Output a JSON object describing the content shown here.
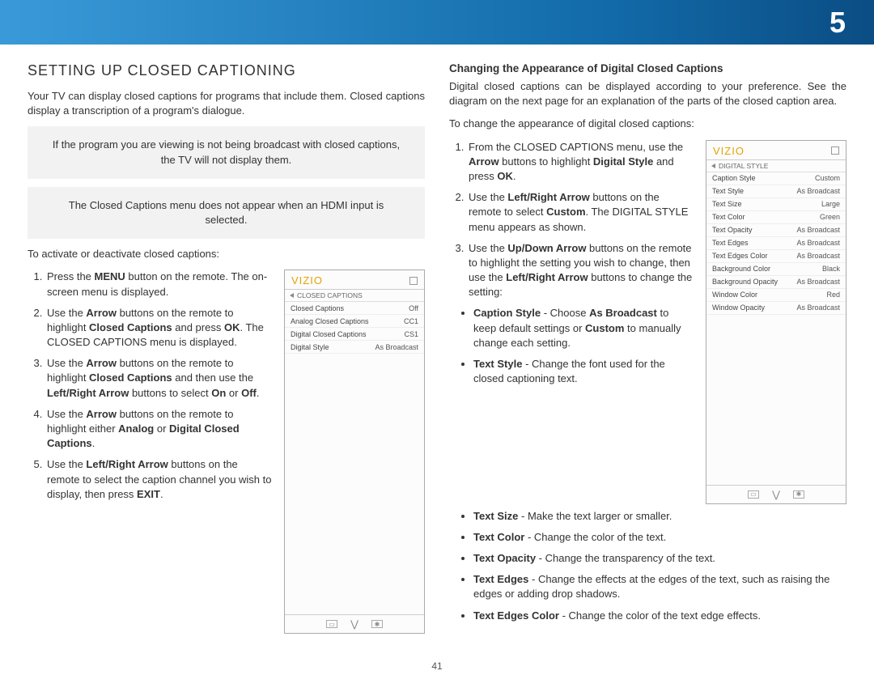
{
  "chapter": "5",
  "page_number": "41",
  "left": {
    "title": "SETTING UP CLOSED CAPTIONING",
    "intro": "Your TV can display closed captions for programs that include them. Closed captions display a transcription of a program's dialogue.",
    "note1": "If the program you are viewing is not being broadcast with closed captions, the TV will not display them.",
    "note2": "The Closed Captions menu does not appear when an HDMI input is selected.",
    "lead": "To activate or deactivate closed captions:",
    "steps": {
      "s1a": "Press the ",
      "s1b": "MENU",
      "s1c": " button on the remote. The on-screen menu is displayed.",
      "s2a": "Use the ",
      "s2b": "Arrow",
      "s2c": " buttons on the remote to highlight ",
      "s2d": "Closed Captions",
      "s2e": " and press ",
      "s2f": "OK",
      "s2g": ". The CLOSED CAPTIONS menu is displayed.",
      "s3a": "Use the ",
      "s3b": "Arrow",
      "s3c": " buttons on the remote to highlight ",
      "s3d": "Closed Captions",
      "s3e": " and then use the ",
      "s3f": "Left/Right Arrow",
      "s3g": " buttons to select ",
      "s3h": "On",
      "s3i": " or ",
      "s3j": "Off",
      "s3k": ".",
      "s4a": "Use the ",
      "s4b": "Arrow",
      "s4c": " buttons on the remote to highlight either ",
      "s4d": "Analog",
      "s4e": " or ",
      "s4f": "Digital Closed Captions",
      "s4g": ".",
      "s5a": "Use the ",
      "s5b": "Left/Right Arrow",
      "s5c": " buttons on the remote to select the caption channel you wish to display, then press ",
      "s5d": "EXIT",
      "s5e": "."
    },
    "panel": {
      "brand": "VIZIO",
      "sub": "CLOSED CAPTIONS",
      "rows": [
        {
          "k": "Closed Captions",
          "v": "Off"
        },
        {
          "k": "Analog Closed Captions",
          "v": "CC1"
        },
        {
          "k": "Digital Closed Captions",
          "v": "CS1"
        },
        {
          "k": "Digital Style",
          "v": "As Broadcast"
        }
      ]
    }
  },
  "right": {
    "title": "Changing the Appearance of Digital Closed Captions",
    "intro": "Digital closed captions can be displayed according to your preference. See the diagram on the next page for an explanation of the parts of the closed caption area.",
    "lead": "To change the appearance of digital closed captions:",
    "steps": {
      "s1a": "From the CLOSED CAPTIONS menu, use the ",
      "s1b": "Arrow",
      "s1c": " buttons to highlight ",
      "s1d": "Digital Style",
      "s1e": " and press ",
      "s1f": "OK",
      "s1g": ".",
      "s2a": "Use the ",
      "s2b": "Left/Right Arrow",
      "s2c": " buttons on the remote to select ",
      "s2d": "Custom",
      "s2e": ". The DIGITAL STYLE menu appears as shown.",
      "s3a": "Use the ",
      "s3b": "Up/Down Arrow",
      "s3c": " buttons on the remote to highlight the setting you wish to change, then use the ",
      "s3d": "Left/Right Arrow",
      "s3e": " buttons to change the setting:"
    },
    "bullets": {
      "b1a": "Caption Style",
      "b1b": " - Choose ",
      "b1c": "As Broadcast",
      "b1d": " to keep default settings or ",
      "b1e": "Custom",
      "b1f": " to manually change each setting.",
      "b2a": "Text Style",
      "b2b": "  - Change the font used for the closed captioning text.",
      "b3a": "Text Size",
      "b3b": " - Make the text larger or smaller.",
      "b4a": "Text Color",
      "b4b": " - Change the color of the text.",
      "b5a": "Text Opacity",
      "b5b": " - Change the transparency of the text.",
      "b6a": "Text Edges",
      "b6b": " - Change the effects at the edges of the text, such as raising the edges or adding drop shadows.",
      "b7a": "Text Edges Color",
      "b7b": " - Change the color of the text edge effects."
    },
    "panel": {
      "brand": "VIZIO",
      "sub": "DIGITAL STYLE",
      "rows": [
        {
          "k": "Caption Style",
          "v": "Custom"
        },
        {
          "k": "Text Style",
          "v": "As Broadcast"
        },
        {
          "k": "Text Size",
          "v": "Large"
        },
        {
          "k": "Text Color",
          "v": "Green"
        },
        {
          "k": "Text Opacity",
          "v": "As Broadcast"
        },
        {
          "k": "Text Edges",
          "v": "As Broadcast"
        },
        {
          "k": "Text Edges Color",
          "v": "As Broadcast"
        },
        {
          "k": "Background Color",
          "v": "Black"
        },
        {
          "k": "Background Opacity",
          "v": "As Broadcast"
        },
        {
          "k": "Window Color",
          "v": "Red"
        },
        {
          "k": "Window Opacity",
          "v": "As Broadcast"
        }
      ]
    }
  }
}
